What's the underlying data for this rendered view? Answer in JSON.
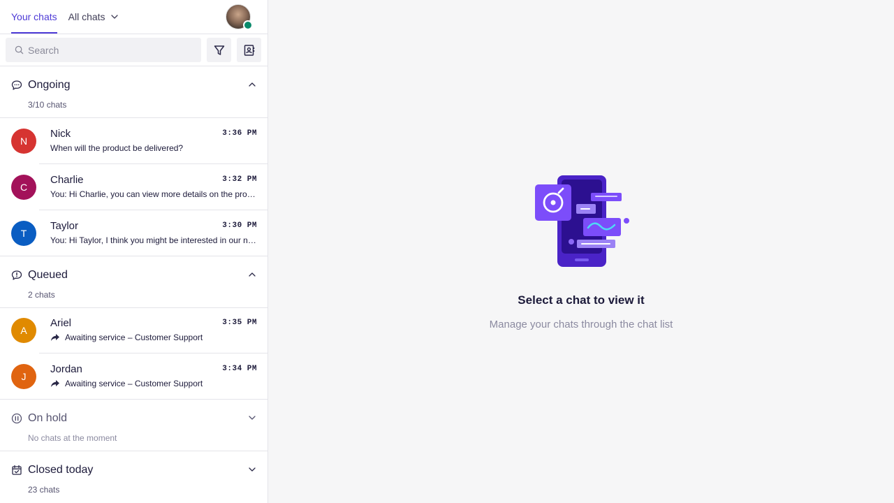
{
  "tabs": {
    "your_chats": "Your chats",
    "all_chats": "All chats"
  },
  "search": {
    "placeholder": "Search"
  },
  "sections": {
    "ongoing": {
      "title": "Ongoing",
      "count": "3/10 chats"
    },
    "queued": {
      "title": "Queued",
      "count": "2 chats"
    },
    "on_hold": {
      "title": "On hold",
      "count": "No chats at the moment"
    },
    "closed": {
      "title": "Closed today",
      "count": "23 chats"
    }
  },
  "chats": {
    "nick": {
      "initial": "N",
      "name": "Nick",
      "time": "3:36 PM",
      "message": "When will the product be delivered?",
      "color": "#d63431"
    },
    "charlie": {
      "initial": "C",
      "name": "Charlie",
      "time": "3:32 PM",
      "message": "You: Hi Charlie, you can view more details on the product page.",
      "color": "#a3125a"
    },
    "taylor": {
      "initial": "T",
      "name": "Taylor",
      "time": "3:30 PM",
      "message": "You: Hi Taylor, I think you might be interested in our new offer.",
      "color": "#0a5dc2"
    },
    "ariel": {
      "initial": "A",
      "name": "Ariel",
      "time": "3:35 PM",
      "message": "Awaiting service – Customer Support",
      "color": "#e08a00"
    },
    "jordan": {
      "initial": "J",
      "name": "Jordan",
      "time": "3:34 PM",
      "message": "Awaiting service – Customer Support",
      "color": "#e06410"
    }
  },
  "empty_state": {
    "title": "Select a chat to view it",
    "subtitle": "Manage your chats through the chat list"
  },
  "colors": {
    "accent": "#4d3ad6",
    "online": "#0a8a6b"
  }
}
